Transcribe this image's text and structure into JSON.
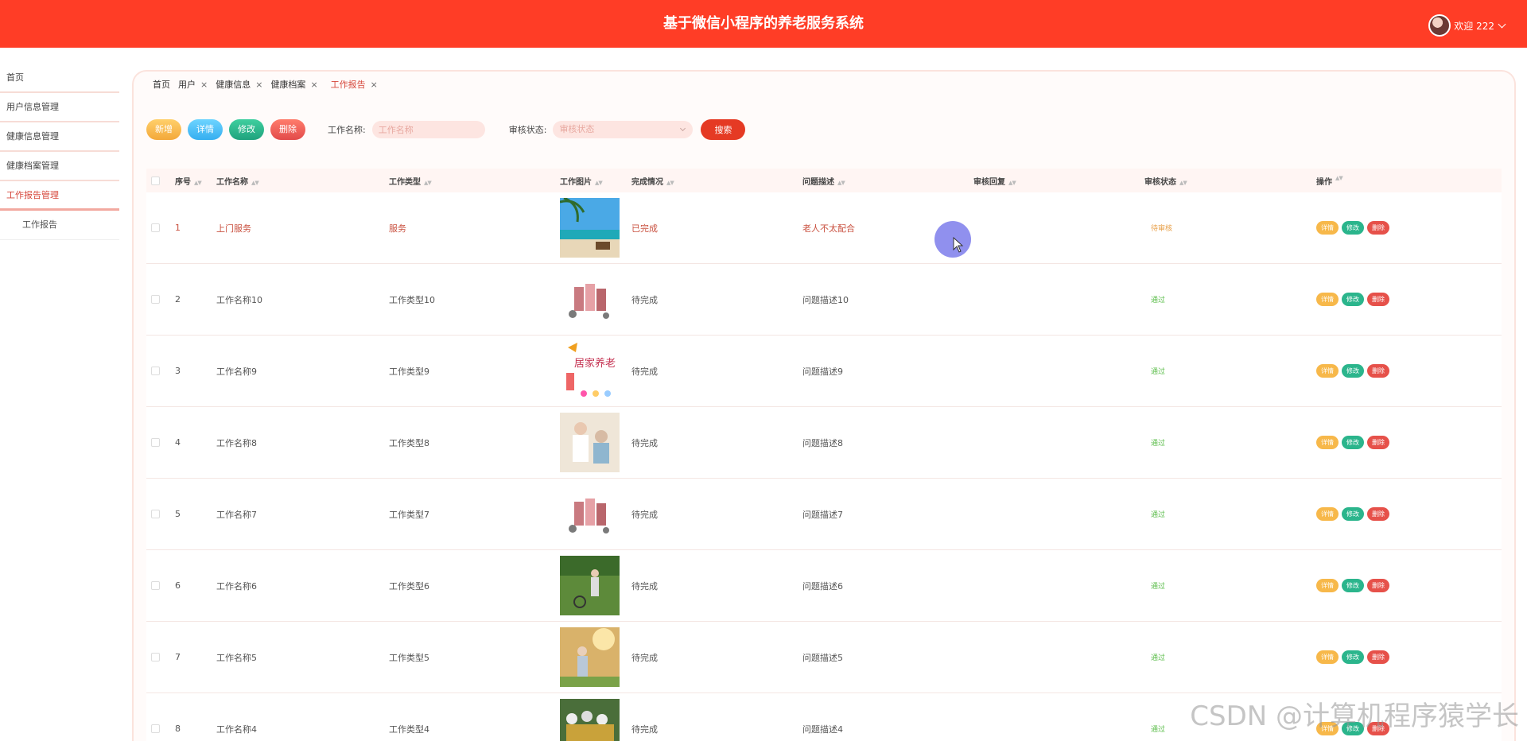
{
  "header": {
    "title": "基于微信小程序的养老服务系统",
    "welcome": "欢迎 222"
  },
  "sidebar": {
    "items": [
      {
        "label": "首页"
      },
      {
        "label": "用户信息管理"
      },
      {
        "label": "健康信息管理"
      },
      {
        "label": "健康档案管理"
      },
      {
        "label": "工作报告管理"
      }
    ],
    "sub_item": "工作报告"
  },
  "tabs": [
    {
      "label": "首页"
    },
    {
      "label": "用户"
    },
    {
      "label": "健康信息"
    },
    {
      "label": "健康档案"
    },
    {
      "label": "工作报告"
    }
  ],
  "toolbar": {
    "add": "新增",
    "detail": "详情",
    "edit": "修改",
    "delete": "删除",
    "name_label": "工作名称:",
    "name_placeholder": "工作名称",
    "status_label": "审核状态:",
    "status_placeholder": "审核状态",
    "search": "搜索"
  },
  "table": {
    "headers": [
      "序号",
      "工作名称",
      "工作类型",
      "工作图片",
      "完成情况",
      "问题描述",
      "审核回复",
      "审核状态",
      "操作"
    ],
    "ops": {
      "detail": "详情",
      "edit": "修改",
      "delete": "删除"
    },
    "rows": [
      {
        "no": "1",
        "name": "上门服务",
        "type": "服务",
        "done": "已完成",
        "desc": "老人不太配合",
        "reply": "",
        "status": "待审核"
      },
      {
        "no": "2",
        "name": "工作名称10",
        "type": "工作类型10",
        "done": "待完成",
        "desc": "问题描述10",
        "reply": "",
        "status": "通过"
      },
      {
        "no": "3",
        "name": "工作名称9",
        "type": "工作类型9",
        "done": "待完成",
        "desc": "问题描述9",
        "reply": "",
        "status": "通过"
      },
      {
        "no": "4",
        "name": "工作名称8",
        "type": "工作类型8",
        "done": "待完成",
        "desc": "问题描述8",
        "reply": "",
        "status": "通过"
      },
      {
        "no": "5",
        "name": "工作名称7",
        "type": "工作类型7",
        "done": "待完成",
        "desc": "问题描述7",
        "reply": "",
        "status": "通过"
      },
      {
        "no": "6",
        "name": "工作名称6",
        "type": "工作类型6",
        "done": "待完成",
        "desc": "问题描述6",
        "reply": "",
        "status": "通过"
      },
      {
        "no": "7",
        "name": "工作名称5",
        "type": "工作类型5",
        "done": "待完成",
        "desc": "问题描述5",
        "reply": "",
        "status": "通过"
      },
      {
        "no": "8",
        "name": "工作名称4",
        "type": "工作类型4",
        "done": "待完成",
        "desc": "问题描述4",
        "reply": "",
        "status": "通过"
      }
    ]
  },
  "watermark": "CSDN @计算机程序猿学长",
  "colors": {
    "header": "#ff3d26",
    "accent": "#d6473b",
    "approved": "#5bbd4a",
    "pending": "#e8a04a"
  }
}
